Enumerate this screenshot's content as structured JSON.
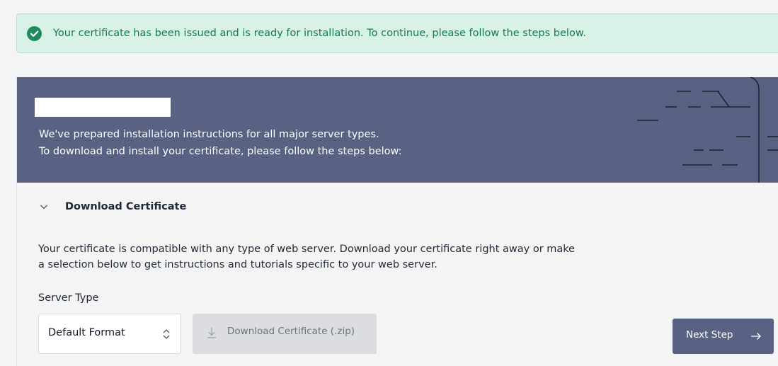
{
  "alert": {
    "message": "Your certificate has been issued and is ready for installation. To continue, please follow the steps below.",
    "icon": "check-circle-icon",
    "color": "#1e8c5a"
  },
  "banner": {
    "line1": "We've prepared installation instructions for all major server types.",
    "line2": "To download and install your certificate, please follow the steps below:",
    "background": "#596283"
  },
  "section": {
    "title": "Download Certificate",
    "expanded": true,
    "description": "Your certificate is compatible with any type of web server. Download your certificate right away or make a selection below to get instructions and tutorials specific to your web server."
  },
  "form": {
    "server_type_label": "Server Type",
    "server_type_value": "Default Format",
    "download_label": "Download Certificate (.zip)",
    "next_label": "Next Step"
  }
}
